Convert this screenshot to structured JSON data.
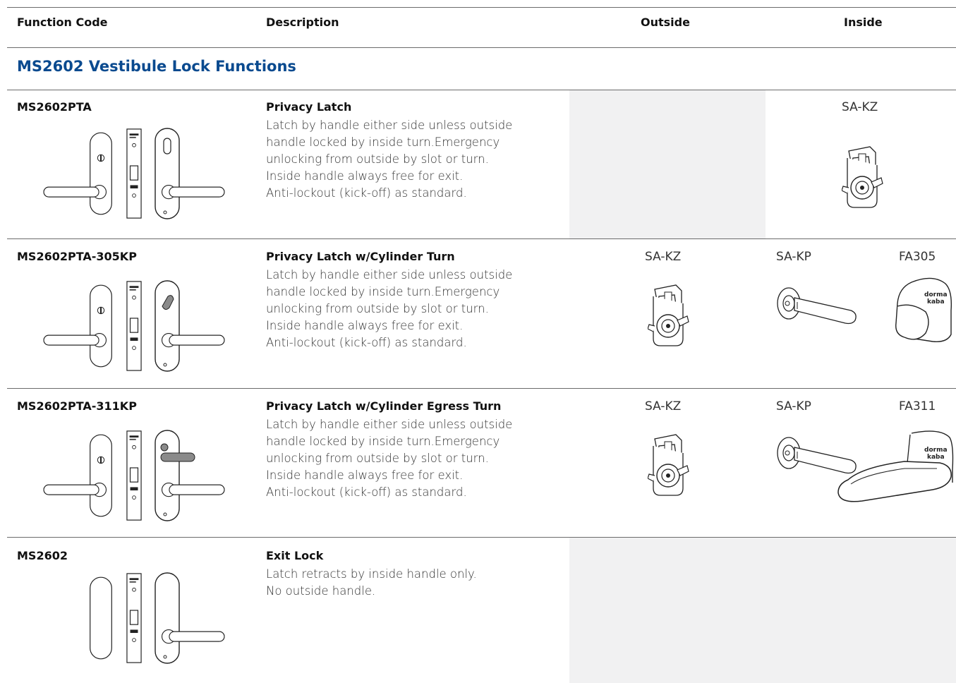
{
  "table": {
    "headers": {
      "function_code": "Function Code",
      "description": "Description",
      "outside": "Outside",
      "inside": "Inside"
    },
    "section_title": "MS2602 Vestibule Lock Functions",
    "rows": [
      {
        "code": "MS2602PTA",
        "title": "Privacy Latch",
        "lines": [
          "Latch by handle either side unless outside",
          "handle locked by inside turn.Emergency",
          "unlocking from outside by slot or turn.",
          "Inside handle always free for exit.",
          "Anti-lockout (kick-off) as standard."
        ],
        "outside_parts": [],
        "inside_parts": [
          "SA-KZ"
        ]
      },
      {
        "code": "MS2602PTA-305KP",
        "title": "Privacy Latch w/Cylinder Turn",
        "lines": [
          "Latch by handle either side unless outside",
          "handle locked by inside turn.Emergency",
          "unlocking from outside by slot or turn.",
          "Inside handle always free for exit.",
          "Anti-lockout (kick-off) as standard."
        ],
        "outside_parts": [
          "SA-KZ"
        ],
        "inside_parts": [
          "SA-KP",
          "FA305"
        ]
      },
      {
        "code": "MS2602PTA-311KP",
        "title": "Privacy Latch w/Cylinder Egress Turn",
        "lines": [
          "Latch by handle either side unless outside",
          "handle locked by inside turn.Emergency",
          "unlocking from outside by slot or turn.",
          "Inside handle always free for exit.",
          "Anti-lockout (kick-off) as standard."
        ],
        "outside_parts": [
          "SA-KZ"
        ],
        "inside_parts": [
          "SA-KP",
          "FA311"
        ]
      },
      {
        "code": "MS2602",
        "title": "Exit Lock",
        "lines": [
          "Latch retracts by inside handle only.",
          "No outside handle."
        ],
        "outside_parts": [],
        "inside_parts": []
      }
    ],
    "logo_text": "dorma kaba"
  },
  "colors": {
    "section_title": "#0a4a8f",
    "gray_fill": "#f1f1f2",
    "rule": "#6b6b6b"
  }
}
